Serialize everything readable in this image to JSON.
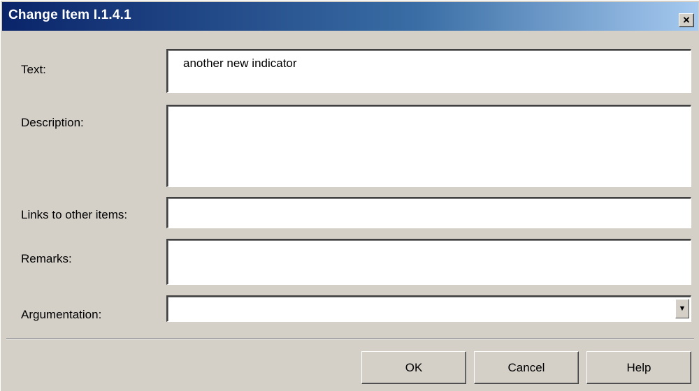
{
  "dialog": {
    "title": "Change Item I.1.4.1",
    "close_glyph": "×"
  },
  "fields": {
    "text": {
      "label": "Text:",
      "value": "another new indicator"
    },
    "description": {
      "label": "Description:",
      "value": ""
    },
    "links": {
      "label": "Links to other items:",
      "value": ""
    },
    "remarks": {
      "label": "Remarks:",
      "value": ""
    },
    "argumentation": {
      "label": "Argumentation:",
      "value": "",
      "arrow_glyph": "▼"
    }
  },
  "buttons": {
    "ok": "OK",
    "cancel": "Cancel",
    "help": "Help"
  },
  "colors": {
    "titlebar_start": "#0a246a",
    "titlebar_end": "#a6caf0",
    "face": "#d4d0c8"
  }
}
